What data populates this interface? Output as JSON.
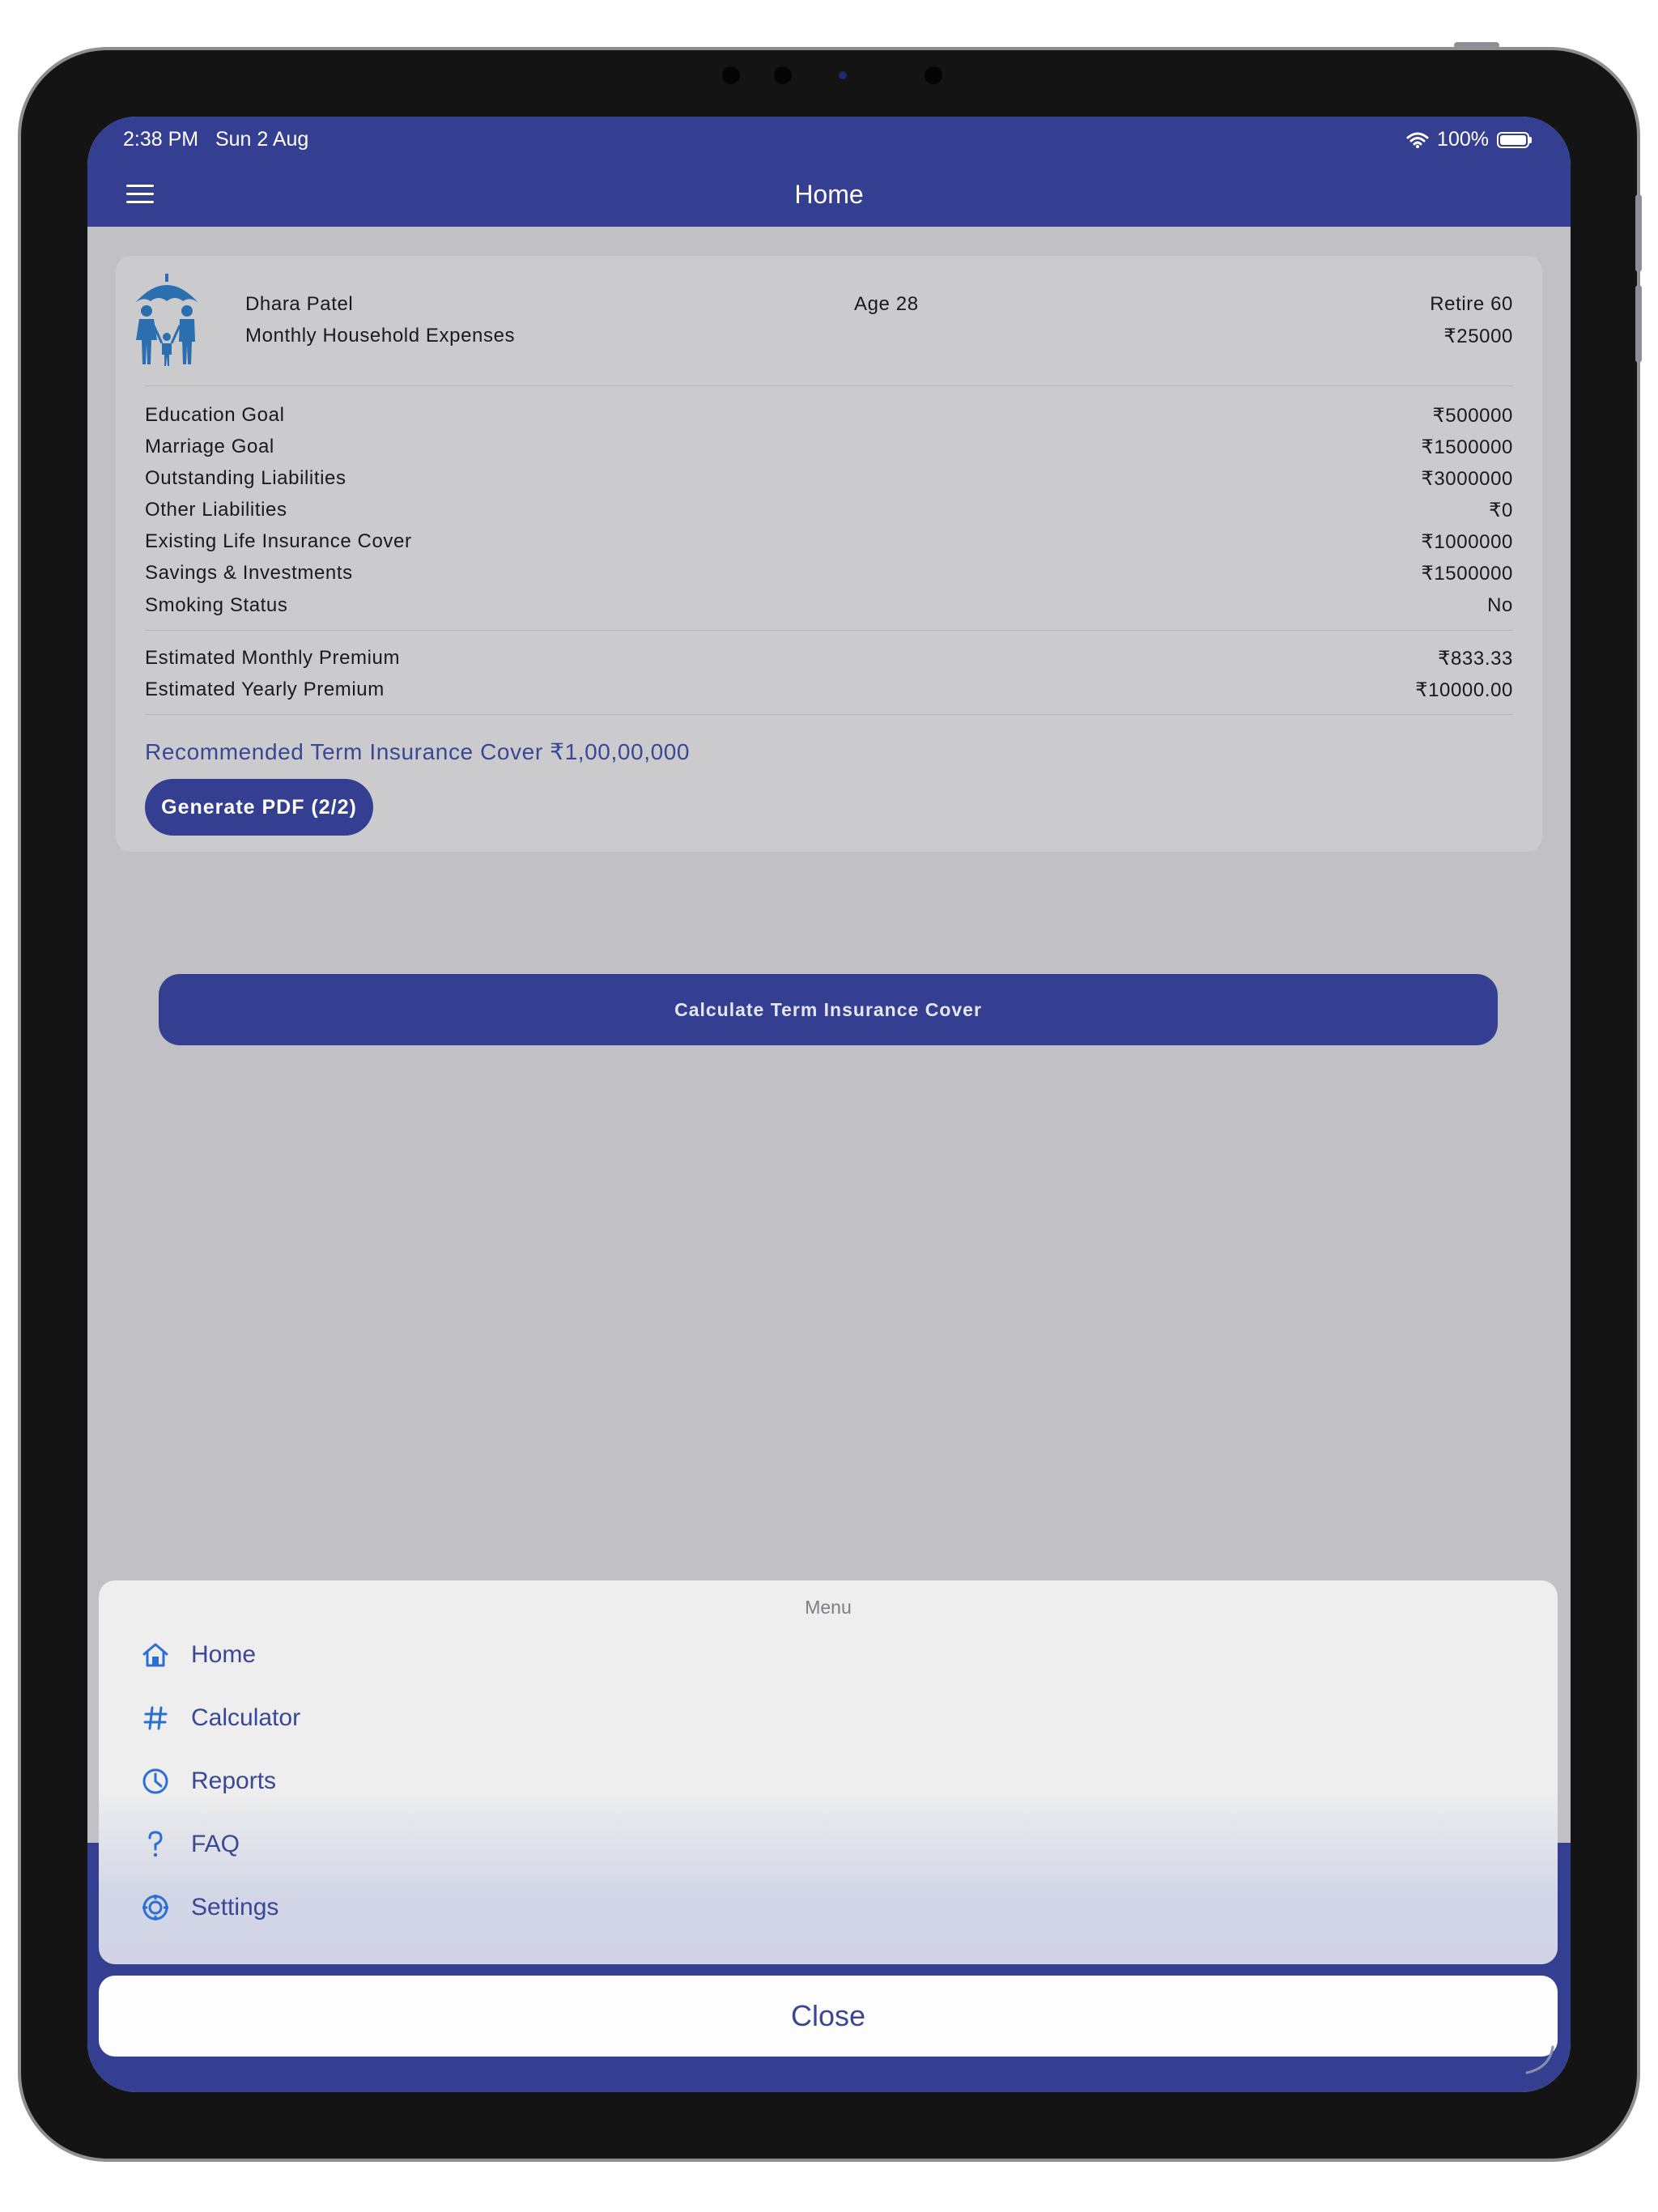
{
  "status_bar": {
    "time": "2:38 PM",
    "date": "Sun 2 Aug",
    "battery": "100%"
  },
  "navbar": {
    "title": "Home"
  },
  "profile": {
    "name": "Dhara Patel",
    "age": "Age 28",
    "retire": "Retire 60",
    "expenses_label": "Monthly Household Expenses",
    "expenses_value": "₹25000"
  },
  "details": [
    {
      "label": "Education Goal",
      "value": "₹500000"
    },
    {
      "label": "Marriage Goal",
      "value": "₹1500000"
    },
    {
      "label": "Outstanding Liabilities",
      "value": "₹3000000"
    },
    {
      "label": "Other Liabilities",
      "value": "₹0"
    },
    {
      "label": "Existing Life Insurance Cover",
      "value": "₹1000000"
    },
    {
      "label": "Savings & Investments",
      "value": "₹1500000"
    },
    {
      "label": "Smoking Status",
      "value": "No"
    }
  ],
  "premiums": [
    {
      "label": "Estimated Monthly Premium",
      "value": "₹833.33"
    },
    {
      "label": "Estimated Yearly Premium",
      "value": "₹10000.00"
    }
  ],
  "recommendation": "Recommended Term Insurance Cover ₹1,00,00,000",
  "pdf_button": "Generate PDF (2/2)",
  "calculate_button": "Calculate Term Insurance Cover",
  "menu": {
    "title": "Menu",
    "items": [
      {
        "label": "Home",
        "icon": "home-icon"
      },
      {
        "label": "Calculator",
        "icon": "hash-icon"
      },
      {
        "label": "Reports",
        "icon": "clock-icon"
      },
      {
        "label": "FAQ",
        "icon": "question-icon"
      },
      {
        "label": "Settings",
        "icon": "settings-icon"
      }
    ],
    "close": "Close"
  },
  "colors": {
    "primary": "#343f92",
    "accent_blue": "#2b6fd6",
    "dim_background": "#c1c0c5"
  }
}
